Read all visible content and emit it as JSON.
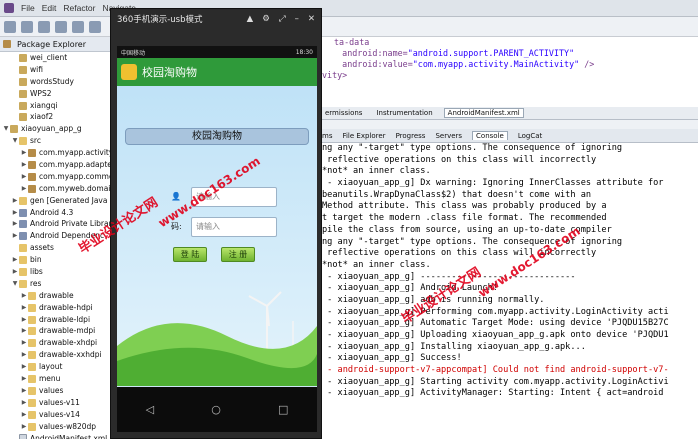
{
  "menubar": {
    "items": [
      "File",
      "Edit",
      "Refactor",
      "Navigate"
    ]
  },
  "package_explorer": {
    "title": "Package Explorer",
    "items": [
      {
        "label": "wei_client",
        "indent": 1,
        "icon": "project-icon"
      },
      {
        "label": "wifi",
        "indent": 1,
        "icon": "project-icon"
      },
      {
        "label": "wordsStudy",
        "indent": 1,
        "icon": "project-icon"
      },
      {
        "label": "WPS2",
        "indent": 1,
        "icon": "project-icon"
      },
      {
        "label": "xiangqi",
        "indent": 1,
        "icon": "project-icon"
      },
      {
        "label": "xiaof2",
        "indent": 1,
        "icon": "project-icon"
      },
      {
        "label": "xiaoyuan_app_g",
        "indent": 0,
        "icon": "project-icon",
        "arrow": "▼"
      },
      {
        "label": "src",
        "indent": 1,
        "icon": "folder-icon",
        "arrow": "▼"
      },
      {
        "label": "com.myapp.activity",
        "indent": 2,
        "icon": "package-icon",
        "arrow": "▶"
      },
      {
        "label": "com.myapp.adapte",
        "indent": 2,
        "icon": "package-icon",
        "arrow": "▶"
      },
      {
        "label": "com.myapp.commo",
        "indent": 2,
        "icon": "package-icon",
        "arrow": "▶"
      },
      {
        "label": "com.myweb.domain",
        "indent": 2,
        "icon": "package-icon",
        "arrow": "▶"
      },
      {
        "label": "gen [Generated Java Fi",
        "indent": 1,
        "icon": "folder-icon",
        "arrow": "▶"
      },
      {
        "label": "Android 4.3",
        "indent": 1,
        "icon": "library-icon",
        "arrow": "▶"
      },
      {
        "label": "Android Private Librar",
        "indent": 1,
        "icon": "library-icon",
        "arrow": "▶"
      },
      {
        "label": "Android Dependenc",
        "indent": 1,
        "icon": "library-icon",
        "arrow": "▶"
      },
      {
        "label": "assets",
        "indent": 1,
        "icon": "folder-icon"
      },
      {
        "label": "bin",
        "indent": 1,
        "icon": "folder-icon",
        "arrow": "▶"
      },
      {
        "label": "libs",
        "indent": 1,
        "icon": "folder-icon",
        "arrow": "▶"
      },
      {
        "label": "res",
        "indent": 1,
        "icon": "folder-icon",
        "arrow": "▼"
      },
      {
        "label": "drawable",
        "indent": 2,
        "icon": "folder-icon",
        "arrow": "▶"
      },
      {
        "label": "drawable-hdpi",
        "indent": 2,
        "icon": "folder-icon",
        "arrow": "▶"
      },
      {
        "label": "drawable-ldpi",
        "indent": 2,
        "icon": "folder-icon",
        "arrow": "▶"
      },
      {
        "label": "drawable-mdpi",
        "indent": 2,
        "icon": "folder-icon",
        "arrow": "▶"
      },
      {
        "label": "drawable-xhdpi",
        "indent": 2,
        "icon": "folder-icon",
        "arrow": "▶"
      },
      {
        "label": "drawable-xxhdpi",
        "indent": 2,
        "icon": "folder-icon",
        "arrow": "▶"
      },
      {
        "label": "layout",
        "indent": 2,
        "icon": "folder-icon",
        "arrow": "▶"
      },
      {
        "label": "menu",
        "indent": 2,
        "icon": "folder-icon",
        "arrow": "▶"
      },
      {
        "label": "values",
        "indent": 2,
        "icon": "folder-icon",
        "arrow": "▶"
      },
      {
        "label": "values-v11",
        "indent": 2,
        "icon": "folder-icon",
        "arrow": "▶"
      },
      {
        "label": "values-v14",
        "indent": 2,
        "icon": "folder-icon",
        "arrow": "▶"
      },
      {
        "label": "values-w820dp",
        "indent": 2,
        "icon": "folder-icon",
        "arrow": "▶"
      },
      {
        "label": "AndroidManifest.xml",
        "indent": 1,
        "icon": "xml-file-icon"
      },
      {
        "label": "ic_launcher-web.png",
        "indent": 1,
        "icon": "image-file-icon"
      }
    ]
  },
  "phone": {
    "window_title": "360手机演示-usb模式",
    "status_left": "中国移动",
    "status_right": "18:30",
    "app_title": "校园淘购物",
    "login_banner": "校园淘购物",
    "username_placeholder": "请输入",
    "password_label": "码:",
    "password_placeholder": "请输入",
    "login_button": "登 陆",
    "register_button": "注 册",
    "nav_back": "◁",
    "nav_home": "○",
    "nav_recent": "□"
  },
  "xml_editor": {
    "lines": [
      {
        "text": "ta-data"
      },
      {
        "prefix": "    android:name=",
        "value": "\"android.support.PARENT_ACTIVITY\""
      },
      {
        "prefix": "    android:value=",
        "value": "\"com.myapp.activity.MainActivity\"",
        "suffix": " />"
      },
      {
        "text": "vity>"
      }
    ]
  },
  "editor_tabs": [
    "ermissions",
    "Instrumentation",
    "AndroidManifest.xml"
  ],
  "bottom_tabs": [
    "ms",
    "File Explorer",
    "Progress",
    "Servers",
    "Console",
    "LogCat"
  ],
  "console": {
    "lines": [
      {
        "text": "ng any \"-target\" type options. The consequence of ignoring"
      },
      {
        "text": " reflective operations on this class will incorrectly"
      },
      {
        "text": "*not* an inner class."
      },
      {
        "text": " - xiaoyuan_app_g] Dx warning: Ignoring InnerClasses attribute for"
      },
      {
        "text": "beanutils.WrapDynaClass$2) that doesn't come with an"
      },
      {
        "text": "Method attribute. This class was probably produced by a"
      },
      {
        "text": "t target the modern .class file format. The recommended"
      },
      {
        "text": "pile the class from source, using an up-to-date compiler"
      },
      {
        "text": "ng any \"-target\" type options. The consequence of ignoring"
      },
      {
        "text": " reflective operations on this class will incorrectly"
      },
      {
        "text": "*not* an inner class."
      },
      {
        "text": " - xiaoyuan_app_g] ------------------------------"
      },
      {
        "text": " - xiaoyuan_app_g] Android Launch!"
      },
      {
        "text": " - xiaoyuan_app_g] adb is running normally."
      },
      {
        "text": " - xiaoyuan_app_g] Performing com.myapp.activity.LoginActivity acti"
      },
      {
        "text": " - xiaoyuan_app_g] Automatic Target Mode: using device 'PJQDU15B27C"
      },
      {
        "text": " - xiaoyuan_app_g] Uploading xiaoyuan_app_g.apk onto device 'PJQDU1"
      },
      {
        "text": " - xiaoyuan_app_g] Installing xiaoyuan_app_g.apk..."
      },
      {
        "text": " - xiaoyuan_app_g] Success!"
      },
      {
        "text": " - android-support-v7-appcompat] Could not find android-support-v7-",
        "error": true
      },
      {
        "text": " - xiaoyuan_app_g] Starting activity com.myapp.activity.LoginActivi"
      },
      {
        "text": " - xiaoyuan_app_g] ActivityManager: Starting: Intent { act=android"
      }
    ]
  },
  "watermarks": [
    "毕业设计论文网",
    "www.doc163.com",
    "毕业设计论文网",
    "www.doc163.com"
  ],
  "colors": {
    "app_bar": "#2f9a3a",
    "error_text": "#d00000",
    "watermark": "#e0001a"
  }
}
